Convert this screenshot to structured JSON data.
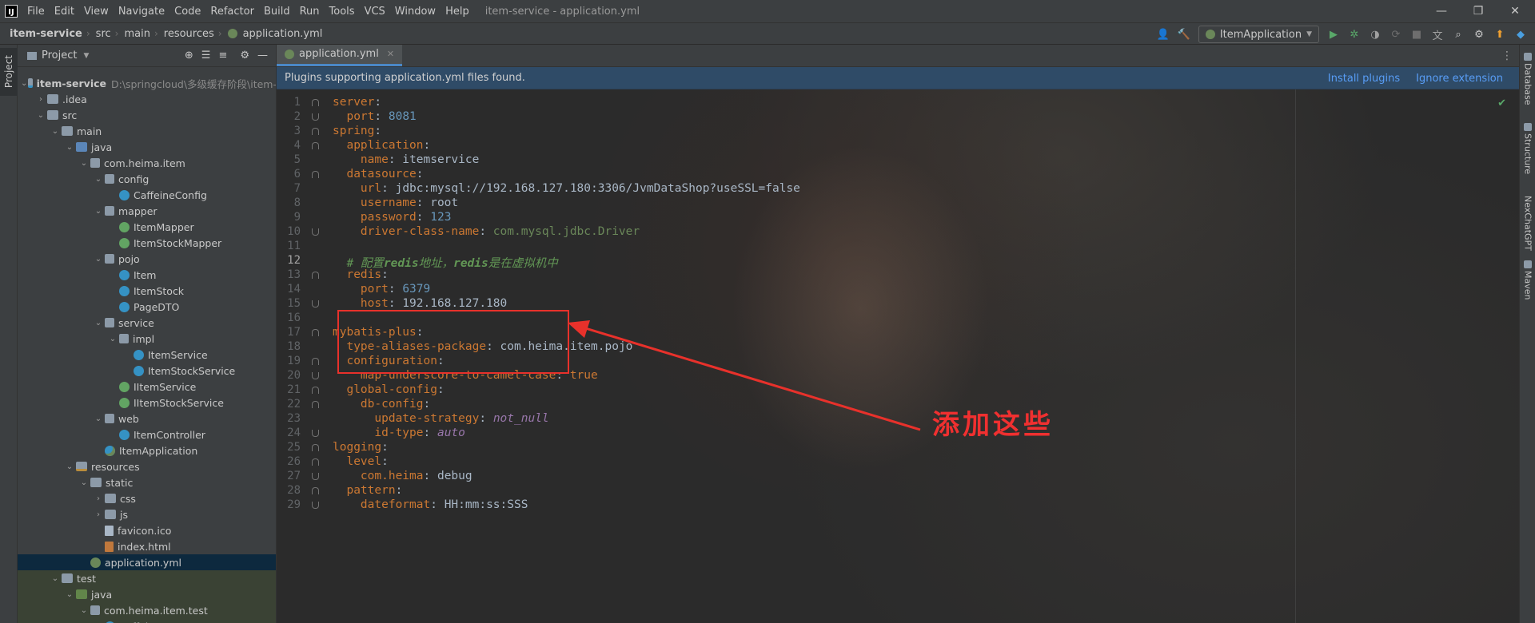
{
  "menubar": {
    "items": [
      "File",
      "Edit",
      "View",
      "Navigate",
      "Code",
      "Refactor",
      "Build",
      "Run",
      "Tools",
      "VCS",
      "Window",
      "Help"
    ],
    "window_title": "item-service - application.yml"
  },
  "breadcrumb": [
    "item-service",
    "src",
    "main",
    "resources",
    "application.yml"
  ],
  "toolbar": {
    "run_config": "ItemApplication"
  },
  "left_stripe": {
    "project_tab": "Project"
  },
  "project": {
    "header": "Project",
    "tree": [
      {
        "label": "item-service",
        "path": "D:\\springcloud\\多级缓存阶段\\item-",
        "icon": "module-icon",
        "depth": 0,
        "open": true,
        "bold": true
      },
      {
        "label": ".idea",
        "icon": "folder-icon",
        "depth": 1,
        "open": false
      },
      {
        "label": "src",
        "icon": "folder-icon",
        "depth": 1,
        "open": true
      },
      {
        "label": "main",
        "icon": "folder-icon",
        "depth": 2,
        "open": true
      },
      {
        "label": "java",
        "icon": "source-folder-icon",
        "depth": 3,
        "open": true
      },
      {
        "label": "com.heima.item",
        "icon": "package-icon",
        "depth": 4,
        "open": true
      },
      {
        "label": "config",
        "icon": "package-icon",
        "depth": 5,
        "open": true
      },
      {
        "label": "CaffeineConfig",
        "icon": "class-icon",
        "depth": 6
      },
      {
        "label": "mapper",
        "icon": "package-icon",
        "depth": 5,
        "open": true
      },
      {
        "label": "ItemMapper",
        "icon": "interface-icon",
        "depth": 6
      },
      {
        "label": "ItemStockMapper",
        "icon": "interface-icon",
        "depth": 6
      },
      {
        "label": "pojo",
        "icon": "package-icon",
        "depth": 5,
        "open": true
      },
      {
        "label": "Item",
        "icon": "class-icon",
        "depth": 6
      },
      {
        "label": "ItemStock",
        "icon": "class-icon",
        "depth": 6
      },
      {
        "label": "PageDTO",
        "icon": "class-icon",
        "depth": 6
      },
      {
        "label": "service",
        "icon": "package-icon",
        "depth": 5,
        "open": true
      },
      {
        "label": "impl",
        "icon": "package-icon",
        "depth": 6,
        "open": true
      },
      {
        "label": "ItemService",
        "icon": "class-icon",
        "depth": 7
      },
      {
        "label": "ItemStockService",
        "icon": "class-icon",
        "depth": 7
      },
      {
        "label": "IItemService",
        "icon": "interface-icon",
        "depth": 6
      },
      {
        "label": "IItemStockService",
        "icon": "interface-icon",
        "depth": 6
      },
      {
        "label": "web",
        "icon": "package-icon",
        "depth": 5,
        "open": true
      },
      {
        "label": "ItemController",
        "icon": "class-icon",
        "depth": 6
      },
      {
        "label": "ItemApplication",
        "icon": "spring-app-icon",
        "depth": 5
      },
      {
        "label": "resources",
        "icon": "resources-folder-icon",
        "depth": 3,
        "open": true
      },
      {
        "label": "static",
        "icon": "folder-icon",
        "depth": 4,
        "open": true
      },
      {
        "label": "css",
        "icon": "folder-icon",
        "depth": 5,
        "open": false
      },
      {
        "label": "js",
        "icon": "folder-icon",
        "depth": 5,
        "open": false
      },
      {
        "label": "favicon.ico",
        "icon": "file-icon",
        "depth": 5
      },
      {
        "label": "index.html",
        "icon": "html-file-icon",
        "depth": 5
      },
      {
        "label": "application.yml",
        "icon": "yml-file-icon",
        "depth": 4,
        "selected": true
      },
      {
        "label": "test",
        "icon": "folder-icon",
        "depth": 2,
        "open": true,
        "test": true
      },
      {
        "label": "java",
        "icon": "test-folder-icon",
        "depth": 3,
        "open": true,
        "test": true
      },
      {
        "label": "com.heima.item.test",
        "icon": "package-icon",
        "depth": 4,
        "open": true,
        "test": true
      },
      {
        "label": "CaffeineTest",
        "icon": "class-icon",
        "depth": 5,
        "test": true
      }
    ]
  },
  "editor": {
    "tab_label": "application.yml",
    "notice_text": "Plugins supporting application.yml files found.",
    "notice_actions": [
      "Install plugins",
      "Ignore extension"
    ],
    "current_line": 12,
    "lines": [
      [
        [
          "k",
          "server"
        ],
        [
          "v",
          ":"
        ]
      ],
      [
        [
          "v",
          "  "
        ],
        [
          "k",
          "port"
        ],
        [
          "v",
          ": "
        ],
        [
          "n",
          "8081"
        ]
      ],
      [
        [
          "k",
          "spring"
        ],
        [
          "v",
          ":"
        ]
      ],
      [
        [
          "v",
          "  "
        ],
        [
          "k",
          "application"
        ],
        [
          "v",
          ":"
        ]
      ],
      [
        [
          "v",
          "    "
        ],
        [
          "k",
          "name"
        ],
        [
          "v",
          ": itemservice"
        ]
      ],
      [
        [
          "v",
          "  "
        ],
        [
          "k",
          "datasource"
        ],
        [
          "v",
          ":"
        ]
      ],
      [
        [
          "v",
          "    "
        ],
        [
          "k",
          "url"
        ],
        [
          "v",
          ": jdbc:mysql://192.168.127.180:3306/JvmDataShop?useSSL=false"
        ]
      ],
      [
        [
          "v",
          "    "
        ],
        [
          "k",
          "username"
        ],
        [
          "v",
          ": root"
        ]
      ],
      [
        [
          "v",
          "    "
        ],
        [
          "k",
          "password"
        ],
        [
          "v",
          ": "
        ],
        [
          "n",
          "123"
        ]
      ],
      [
        [
          "v",
          "    "
        ],
        [
          "k",
          "driver-class-name"
        ],
        [
          "v",
          ": "
        ],
        [
          "s",
          "com.mysql.jdbc.Driver"
        ]
      ],
      [],
      [
        [
          "v",
          "  "
        ],
        [
          "c",
          "# 配置"
        ],
        [
          "cb",
          "redis"
        ],
        [
          "c",
          "地址，"
        ],
        [
          "cb",
          "redis"
        ],
        [
          "c",
          "是在虚拟机中"
        ]
      ],
      [
        [
          "v",
          "  "
        ],
        [
          "k",
          "redis"
        ],
        [
          "v",
          ":"
        ]
      ],
      [
        [
          "v",
          "    "
        ],
        [
          "k",
          "port"
        ],
        [
          "v",
          ": "
        ],
        [
          "n",
          "6379"
        ]
      ],
      [
        [
          "v",
          "    "
        ],
        [
          "k",
          "host"
        ],
        [
          "v",
          ": 192.168.127.180"
        ]
      ],
      [],
      [
        [
          "k",
          "mybatis-plus"
        ],
        [
          "v",
          ":"
        ]
      ],
      [
        [
          "v",
          "  "
        ],
        [
          "k",
          "type-aliases-package"
        ],
        [
          "v",
          ": com.heima.item.pojo"
        ]
      ],
      [
        [
          "v",
          "  "
        ],
        [
          "k",
          "configuration"
        ],
        [
          "v",
          ":"
        ]
      ],
      [
        [
          "v",
          "    "
        ],
        [
          "k",
          "map-underscore-to-camel-case"
        ],
        [
          "v",
          ": "
        ],
        [
          "k",
          "true"
        ]
      ],
      [
        [
          "v",
          "  "
        ],
        [
          "k",
          "global-config"
        ],
        [
          "v",
          ":"
        ]
      ],
      [
        [
          "v",
          "    "
        ],
        [
          "k",
          "db-config"
        ],
        [
          "v",
          ":"
        ]
      ],
      [
        [
          "v",
          "      "
        ],
        [
          "k",
          "update-strategy"
        ],
        [
          "v",
          ": "
        ],
        [
          "it",
          "not_null"
        ]
      ],
      [
        [
          "v",
          "      "
        ],
        [
          "k",
          "id-type"
        ],
        [
          "v",
          ": "
        ],
        [
          "it",
          "auto"
        ]
      ],
      [
        [
          "k",
          "logging"
        ],
        [
          "v",
          ":"
        ]
      ],
      [
        [
          "v",
          "  "
        ],
        [
          "k",
          "level"
        ],
        [
          "v",
          ":"
        ]
      ],
      [
        [
          "v",
          "    "
        ],
        [
          "k",
          "com.heima"
        ],
        [
          "v",
          ": "
        ],
        [
          "v",
          "debug"
        ]
      ],
      [
        [
          "v",
          "  "
        ],
        [
          "k",
          "pattern"
        ],
        [
          "v",
          ":"
        ]
      ],
      [
        [
          "v",
          "    "
        ],
        [
          "k",
          "dateformat"
        ],
        [
          "v",
          ": HH:mm:ss:SSS"
        ]
      ]
    ]
  },
  "annotation": {
    "text": "添加这些"
  },
  "right_stripe": [
    "Database",
    "Structure",
    "NexChatGPT",
    "Maven"
  ],
  "colors": {
    "annotation_red": "#e8312b",
    "selection": "#0d293e",
    "notice_bg": "#2f4b67",
    "link": "#589df6"
  }
}
